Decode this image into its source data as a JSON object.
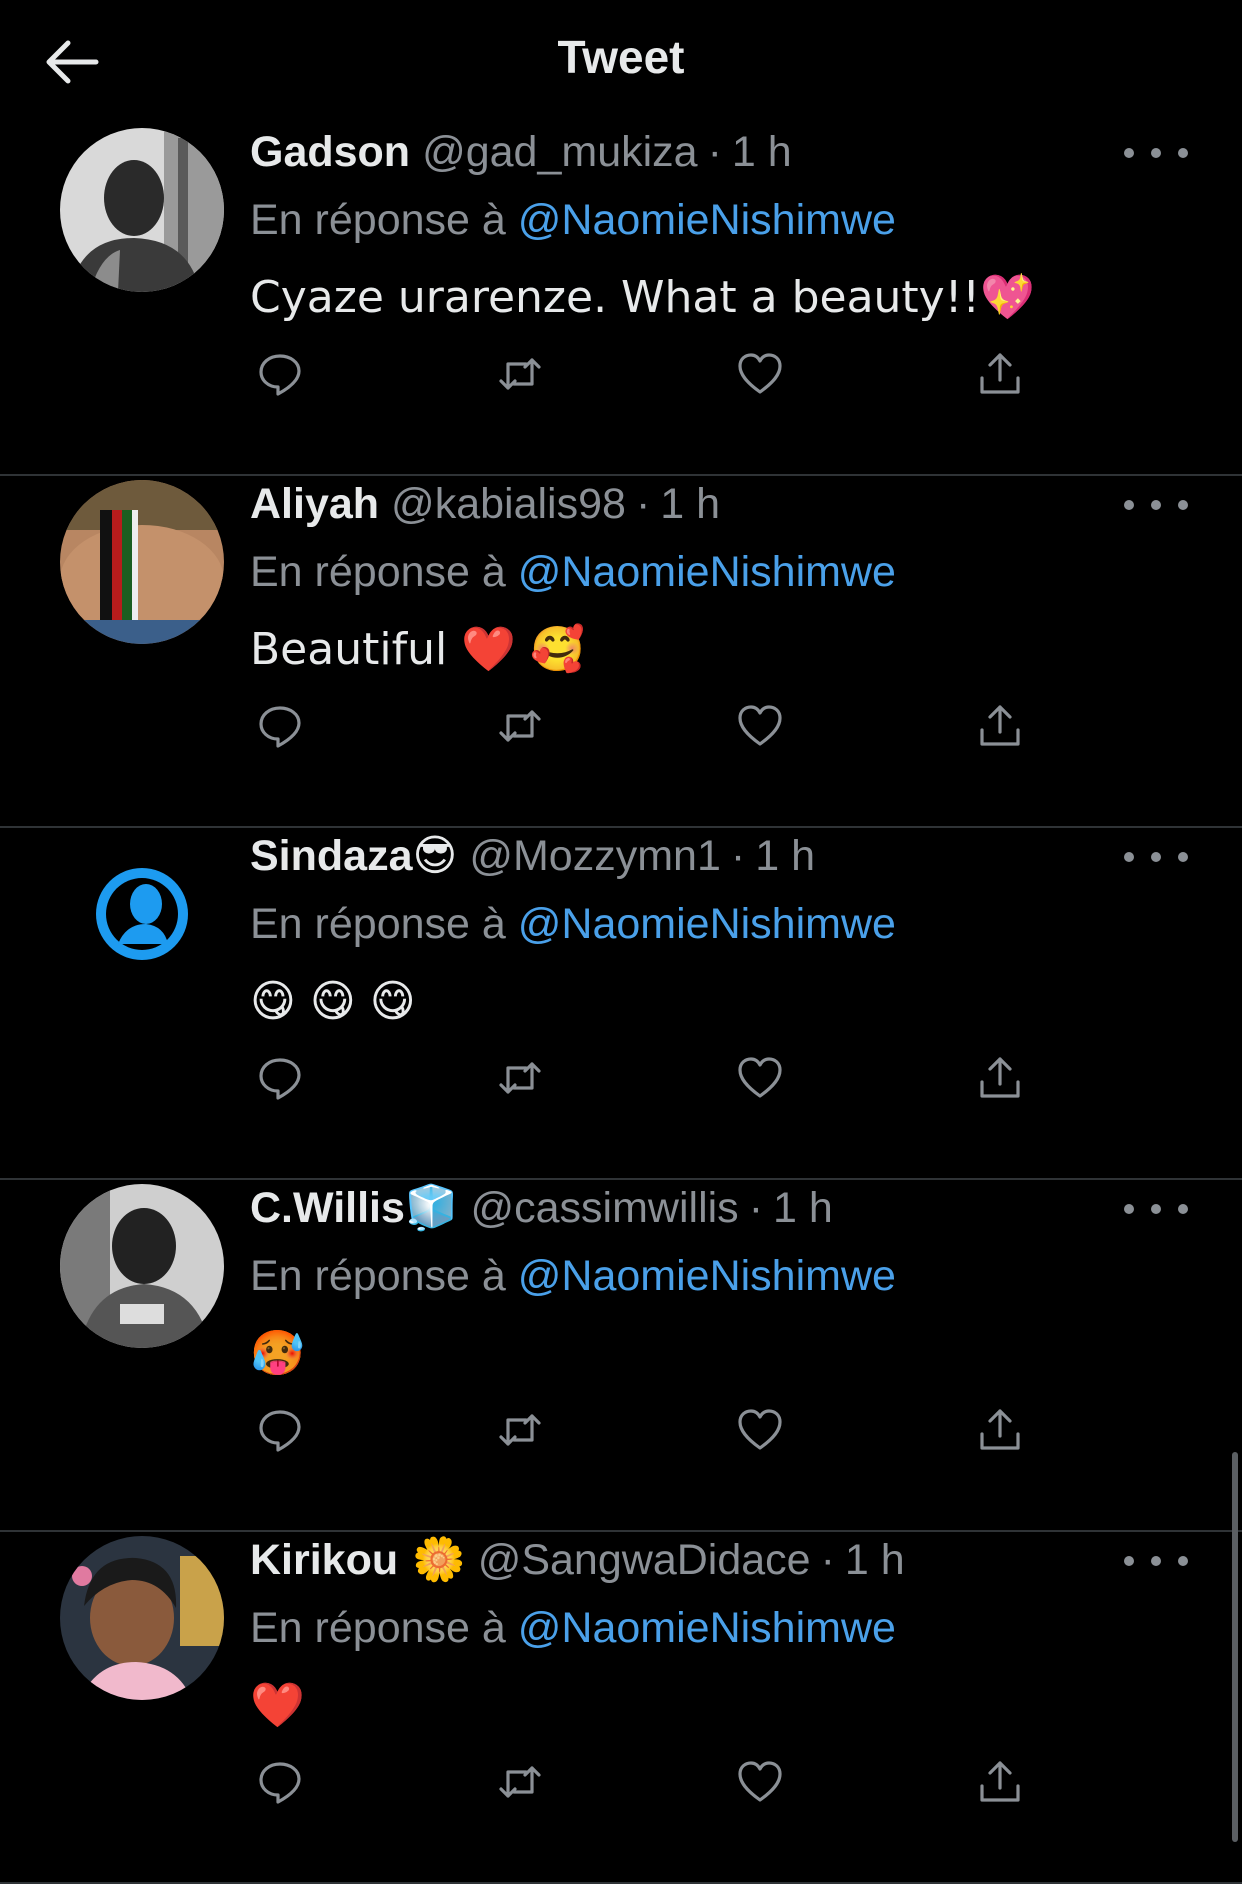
{
  "header": {
    "title": "Tweet",
    "back_icon": "arrow-left-icon"
  },
  "colors": {
    "background": "#000000",
    "text": "#e7e9ea",
    "secondary": "#8b9096",
    "link": "#4aa0e9",
    "divider": "#2f3336"
  },
  "reply_prefix": "En réponse à",
  "tweets": [
    {
      "name": "Gadson",
      "name_emoji": "",
      "handle": "@gad_mukiza",
      "time": "1 h",
      "reply_to": "@NaomieNishimwe",
      "text": "Cyaze urarenze. What a beauty!!💖",
      "avatar": "photo-man-grayscale"
    },
    {
      "name": "Aliyah",
      "name_emoji": "",
      "handle": "@kabialis98",
      "time": "1 h",
      "reply_to": "@NaomieNishimwe",
      "text": "Beautiful ❤️ 🥰",
      "avatar": "photo-beaded-bracelet"
    },
    {
      "name": "Sindaza",
      "name_emoji": "😎",
      "handle": "@Mozzymn1",
      "time": "1 h",
      "reply_to": "@NaomieNishimwe",
      "text": "😋 😋 😋",
      "avatar": "default-profile-silhouette"
    },
    {
      "name": "C.Willis",
      "name_emoji": "🧊",
      "handle": "@cassimwillis",
      "time": "1 h",
      "reply_to": "@NaomieNishimwe",
      "text": "🥵",
      "avatar": "photo-man-grayscale"
    },
    {
      "name": "Kirikou",
      "name_emoji": "🌼",
      "handle": "@SangwaDidace",
      "time": "1 h",
      "reply_to": "@NaomieNishimwe",
      "text": "❤️",
      "avatar": "photo-girl"
    }
  ],
  "action_icons": [
    "reply-icon",
    "retweet-icon",
    "like-icon",
    "share-icon"
  ],
  "separator": "·"
}
